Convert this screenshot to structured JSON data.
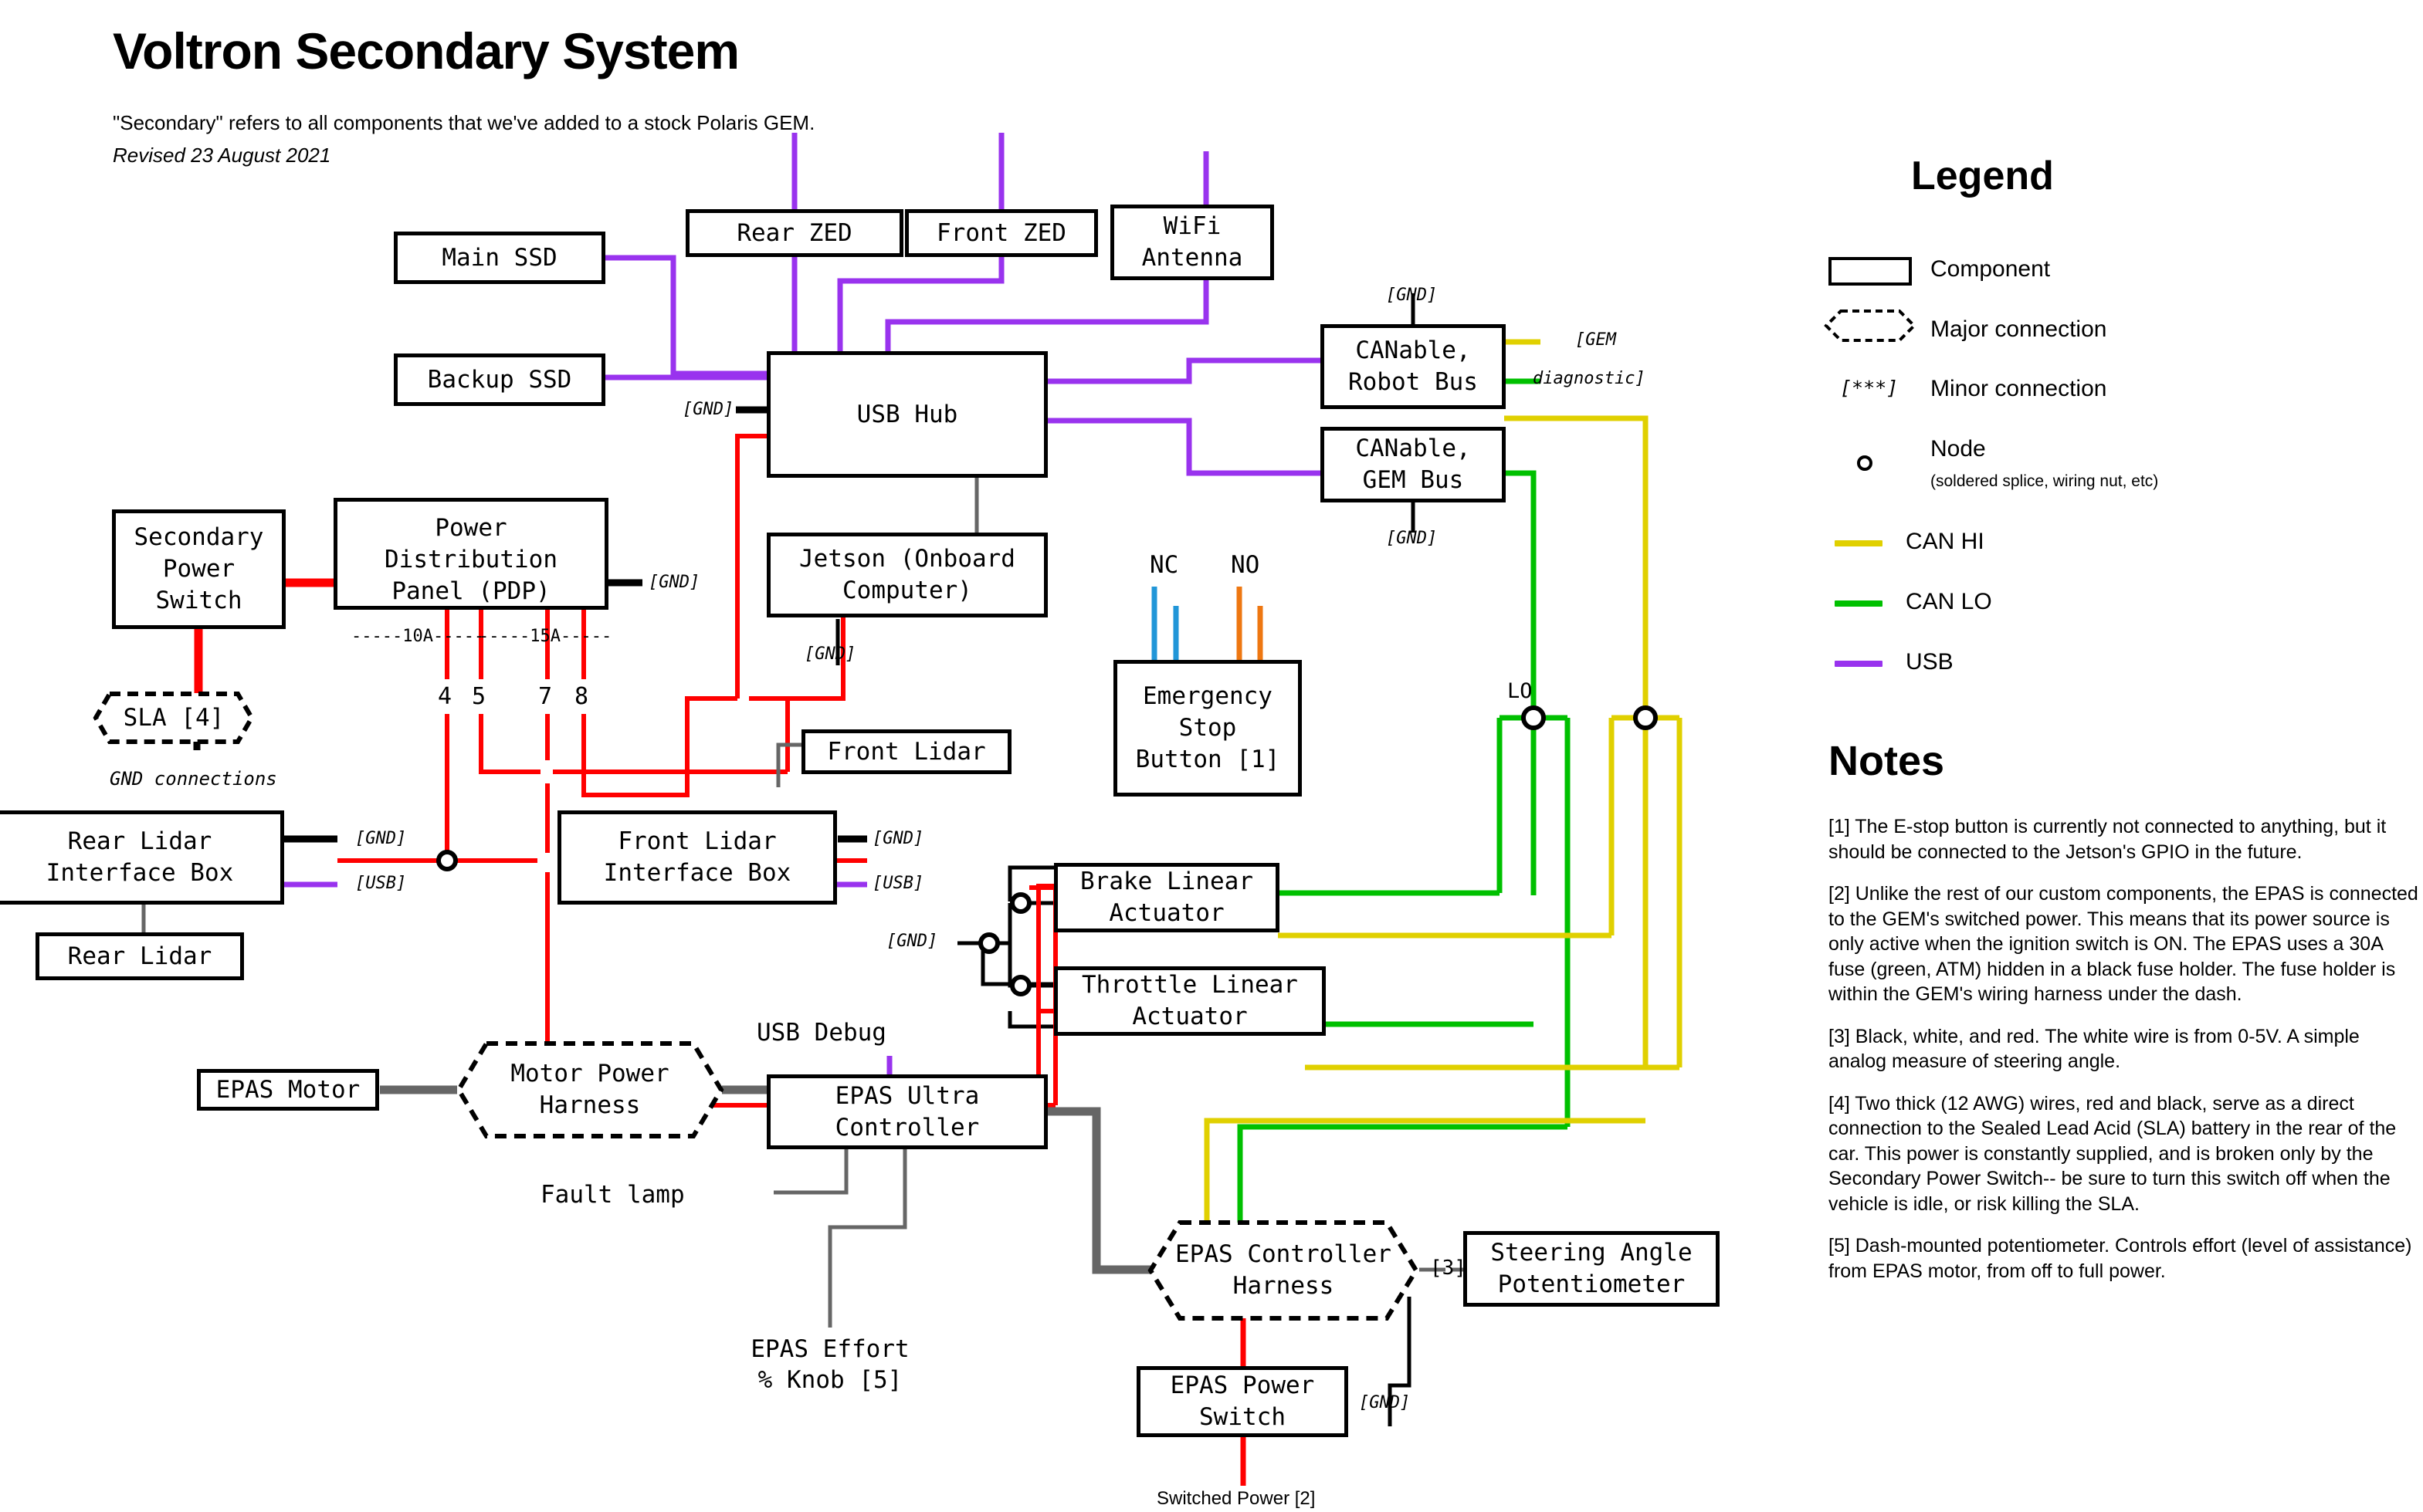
{
  "header": {
    "title": "Voltron Secondary System",
    "subtitle": "\"Secondary\" refers to all components that we've added to a stock Polaris GEM.",
    "revised": "Revised 23 August 2021"
  },
  "colors": {
    "can_hi": "#e0d000",
    "can_lo": "#00c000",
    "usb": "#9933ee",
    "power": "#ff0000",
    "ground": "#000000",
    "signal": "#666666",
    "nc_wire": "#2196d8",
    "no_wire": "#ee7711"
  },
  "components": [
    {
      "id": "main-ssd",
      "label": "Main SSD"
    },
    {
      "id": "backup-ssd",
      "label": "Backup SSD"
    },
    {
      "id": "rear-zed",
      "label": "Rear ZED"
    },
    {
      "id": "front-zed",
      "label": "Front ZED"
    },
    {
      "id": "wifi-antenna",
      "label": "WiFi\nAntenna"
    },
    {
      "id": "usb-hub",
      "label": "USB Hub"
    },
    {
      "id": "canable-robot",
      "label": "CANable,\nRobot Bus"
    },
    {
      "id": "canable-gem",
      "label": "CANable,\nGEM Bus"
    },
    {
      "id": "jetson",
      "label": "Jetson (Onboard\nComputer)"
    },
    {
      "id": "secondary-power-switch",
      "label": "Secondary\nPower\nSwitch"
    },
    {
      "id": "pdp",
      "label": "Power\nDistribution\nPanel (PDP)"
    },
    {
      "id": "front-lidar",
      "label": "Front Lidar"
    },
    {
      "id": "rear-lidar-interface-box",
      "label": "Rear Lidar\nInterface Box"
    },
    {
      "id": "rear-lidar",
      "label": "Rear Lidar"
    },
    {
      "id": "front-lidar-interface-box",
      "label": "Front Lidar\nInterface Box"
    },
    {
      "id": "emergency-stop",
      "label": "Emergency\nStop\nButton [1]"
    },
    {
      "id": "brake-actuator",
      "label": "Brake Linear\nActuator"
    },
    {
      "id": "throttle-actuator",
      "label": "Throttle Linear\nActuator"
    },
    {
      "id": "epas-motor",
      "label": "EPAS Motor"
    },
    {
      "id": "epas-ultra-controller",
      "label": "EPAS Ultra\nController"
    },
    {
      "id": "steering-angle-pot",
      "label": "Steering Angle\nPotentiometer"
    },
    {
      "id": "epas-power-switch",
      "label": "EPAS Power\nSwitch"
    }
  ],
  "harnesses": [
    {
      "id": "sla",
      "label": "SLA [4]"
    },
    {
      "id": "motor-power-harness",
      "label": "Motor Power\nHarness"
    },
    {
      "id": "epas-controller-harness",
      "label": "EPAS Controller\nHarness"
    }
  ],
  "wire_tags": {
    "gnd": "[GND]",
    "usb": "[USB]",
    "gem_diag_1": "[GEM",
    "gem_diag_2": "diagnostic]",
    "note3": "[3]"
  },
  "floating_labels": {
    "gnd_connections": "GND connections",
    "nc": "NC",
    "no": "NO",
    "lo": "LO",
    "usb_debug": "USB Debug",
    "fault_lamp": "Fault lamp",
    "epas_effort_knob": "EPAS Effort\n% Knob [5]",
    "switched_power": "Switched Power [2]",
    "fuse_10a": "-----10A-----",
    "fuse_15a": "-----15A-----",
    "pdp_port_4": "4",
    "pdp_port_5": "5",
    "pdp_port_7": "7",
    "pdp_port_8": "8"
  },
  "legend": {
    "title": "Legend",
    "items": [
      {
        "id": "component",
        "label": "Component",
        "sub": ""
      },
      {
        "id": "major-connection",
        "label": "Major connection",
        "sub": ""
      },
      {
        "id": "minor-connection",
        "label": "Minor connection",
        "sub": "",
        "glyph": "[***]"
      },
      {
        "id": "node",
        "label": "Node",
        "sub": "(soldered splice, wiring nut, etc)"
      },
      {
        "id": "can-hi",
        "label": "CAN HI",
        "color": "#e0d000"
      },
      {
        "id": "can-lo",
        "label": "CAN LO",
        "color": "#00c000"
      },
      {
        "id": "usb",
        "label": "USB",
        "color": "#9933ee"
      }
    ]
  },
  "notes": {
    "title": "Notes",
    "items": [
      "[1] The E-stop button is currently not connected to anything, but it should be connected to the Jetson's GPIO in the future.",
      "[2] Unlike the rest of our custom components, the EPAS is connected to the GEM's switched power. This means that its power source is only active when the ignition switch is ON. The EPAS uses a 30A fuse (green, ATM) hidden in a black fuse holder. The fuse holder is within the GEM's wiring harness under the dash.",
      "[3] Black, white, and red. The white wire is from 0-5V. A simple analog measure of steering angle.",
      "[4] Two thick (12 AWG) wires, red and black, serve as a direct connection to the Sealed Lead Acid (SLA) battery in the rear of the car. This power is constantly supplied, and is broken only by the Secondary Power Switch-- be sure to turn this switch off when the vehicle is idle, or risk killing the SLA.",
      "[5] Dash-mounted potentiometer. Controls effort (level of assistance) from EPAS motor, from off to full power."
    ]
  }
}
